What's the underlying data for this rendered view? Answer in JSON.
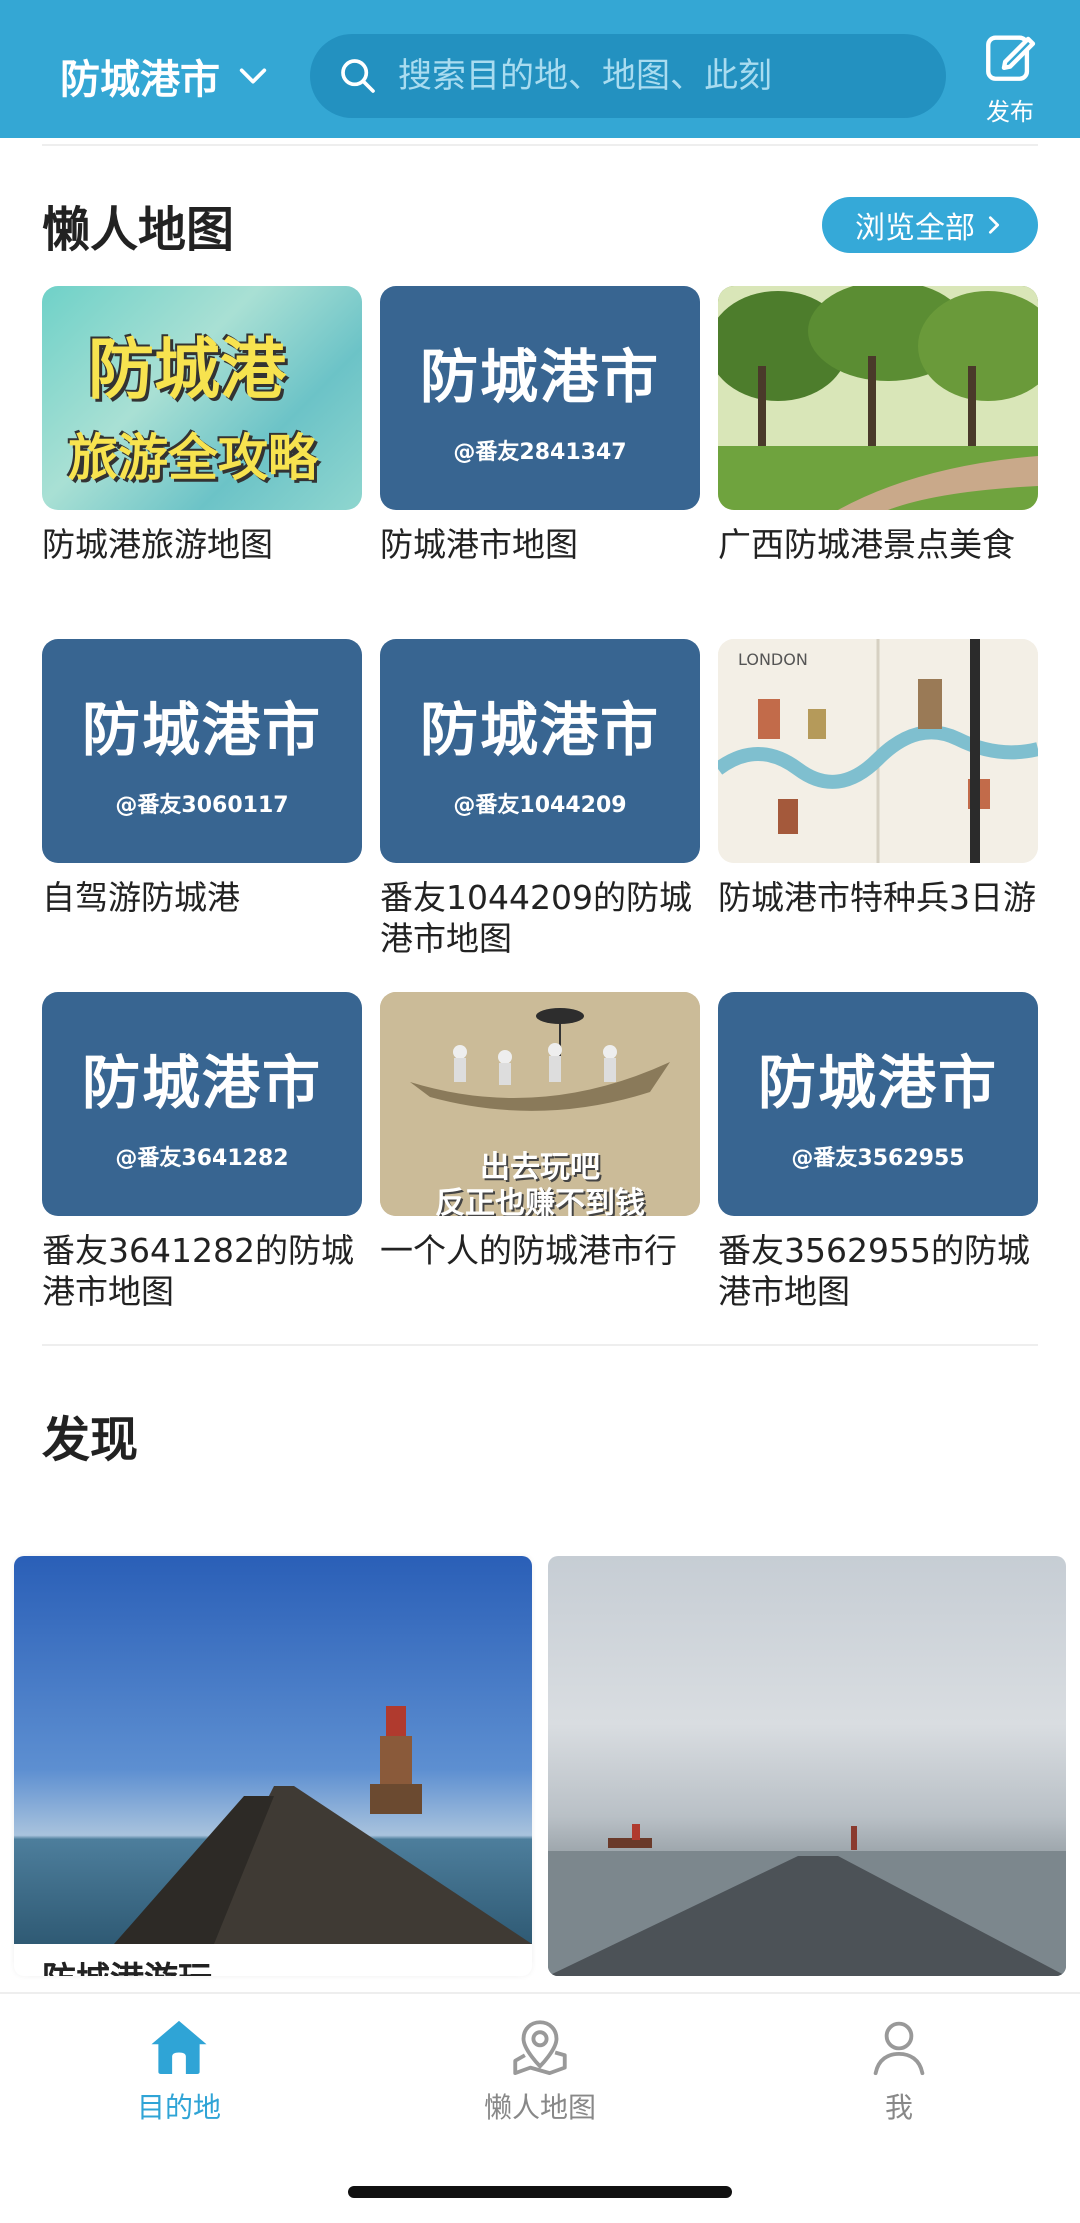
{
  "header": {
    "city": "防城港市",
    "search_placeholder": "搜索目的地、地图、此刻",
    "publish_label": "发布"
  },
  "lazy_maps": {
    "title": "懒人地图",
    "browse_all": "浏览全部",
    "items": [
      {
        "caption": "防城港旅游地图",
        "thumb_line1": "防城港",
        "thumb_line2": "旅游全攻略"
      },
      {
        "caption": "防城港市地图",
        "thumb_line1": "防城港市",
        "thumb_line2": "@番友2841347"
      },
      {
        "caption": "广西防城港景点美食"
      },
      {
        "caption": "自驾游防城港",
        "thumb_line1": "防城港市",
        "thumb_line2": "@番友3060117"
      },
      {
        "caption": "番友1044209的防城港市地图",
        "thumb_line1": "防城港市",
        "thumb_line2": "@番友1044209"
      },
      {
        "caption": "防城港市特种兵3日游",
        "thumb_line1": "LONDON"
      },
      {
        "caption": "番友3641282的防城港市地图",
        "thumb_line1": "防城港市",
        "thumb_line2": "@番友3641282"
      },
      {
        "caption": "一个人的防城港市行",
        "thumb_line1": "出去玩吧",
        "thumb_line2": "反正也赚不到钱"
      },
      {
        "caption": "番友3562955的防城港市地图",
        "thumb_line1": "防城港市",
        "thumb_line2": "@番友3562955"
      }
    ]
  },
  "discover": {
    "title": "发现",
    "cards": [
      {
        "caption": "防城港游玩"
      }
    ]
  },
  "tabbar": {
    "tabs": [
      {
        "label": "目的地",
        "icon": "home-icon",
        "active": true
      },
      {
        "label": "懒人地图",
        "icon": "map-pin-icon",
        "active": false
      },
      {
        "label": "我",
        "icon": "user-icon",
        "active": false
      }
    ]
  },
  "colors": {
    "accent": "#34a7d4",
    "map_tile": "#386591",
    "active_tab": "#2fa4d6"
  }
}
